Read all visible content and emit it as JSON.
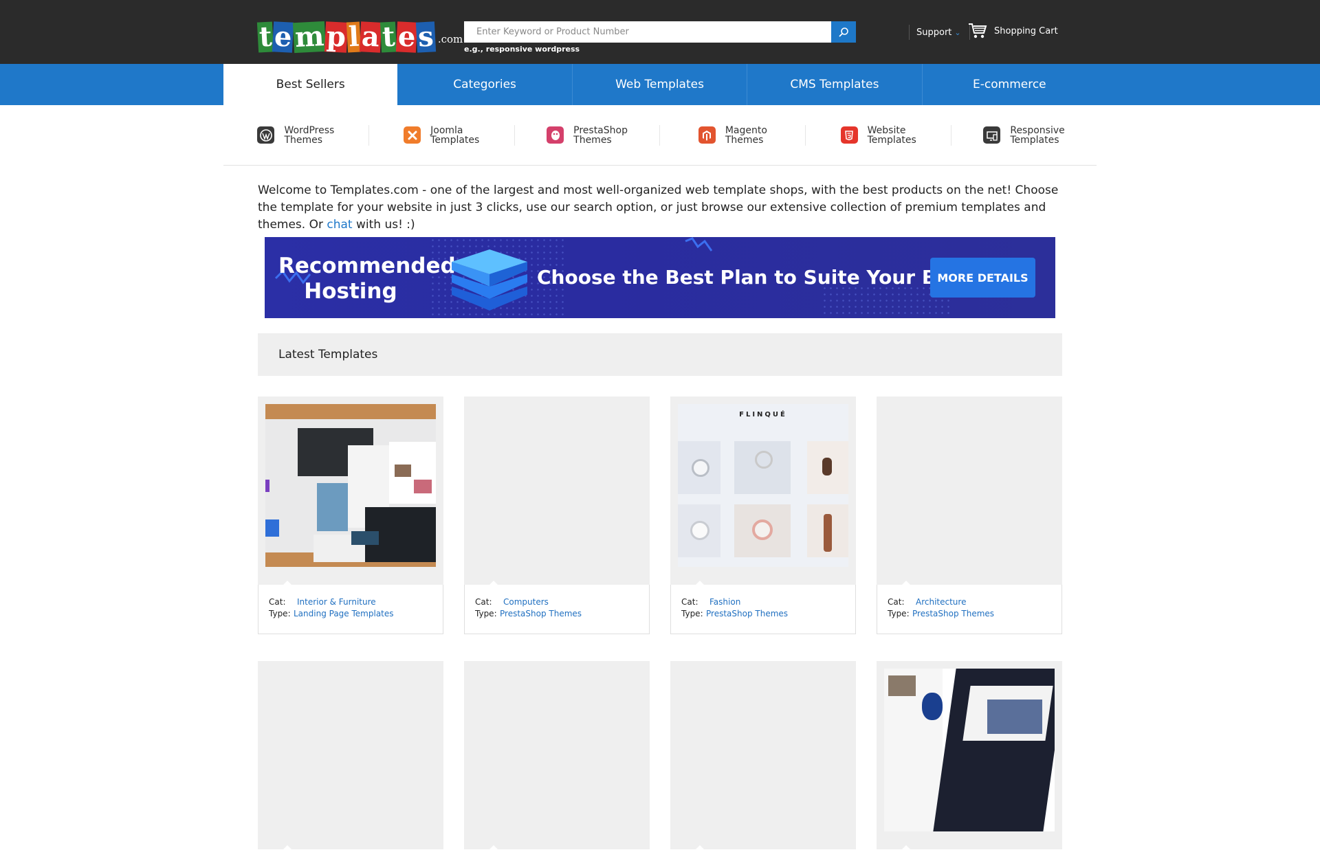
{
  "header": {
    "logo": {
      "letters": [
        {
          "ch": "t",
          "bg": "#2e8b3a"
        },
        {
          "ch": "e",
          "bg": "#1d5fb0"
        },
        {
          "ch": "m",
          "bg": "#2e8b3a"
        },
        {
          "ch": "p",
          "bg": "#d92c2c"
        },
        {
          "ch": "l",
          "bg": "#e07a1a"
        },
        {
          "ch": "a",
          "bg": "#d92c2c"
        },
        {
          "ch": "t",
          "bg": "#2e8b3a"
        },
        {
          "ch": "e",
          "bg": "#d92c2c"
        },
        {
          "ch": "s",
          "bg": "#1d5fb0"
        }
      ],
      "suffix": ".com"
    },
    "search": {
      "placeholder": "Enter Keyword or Product Number",
      "hint": "e.g., responsive wordpress"
    },
    "support_label": "Support",
    "cart_label": "Shopping Cart"
  },
  "nav": {
    "tabs": [
      {
        "label": "Best Sellers",
        "active": true
      },
      {
        "label": "Categories"
      },
      {
        "label": "Web Templates"
      },
      {
        "label": "CMS Templates"
      },
      {
        "label": "E-commerce"
      }
    ]
  },
  "subnav": {
    "items": [
      {
        "line1": "WordPress",
        "line2": "Themes",
        "icon": "wordpress-icon",
        "color": "#3a3a3a"
      },
      {
        "line1": "Joomla",
        "line2": "Templates",
        "icon": "joomla-icon",
        "color": "#f07c2b"
      },
      {
        "line1": "PrestaShop",
        "line2": "Themes",
        "icon": "prestashop-icon",
        "color": "#d4406b"
      },
      {
        "line1": "Magento",
        "line2": "Themes",
        "icon": "magento-icon",
        "color": "#e2542f"
      },
      {
        "line1": "Website",
        "line2": "Templates",
        "icon": "html5-icon",
        "color": "#e5352b"
      },
      {
        "line1": "Responsive",
        "line2": "Templates",
        "icon": "responsive-icon",
        "color": "#3a3a3a"
      }
    ]
  },
  "welcome": {
    "text_before": "Welcome to Templates.com - one of the largest and most well-organized web template shops, with the best products on the net! Choose the template for your website in just 3 clicks, use our search option, or just browse our extensive collection of premium templates and themes. Or ",
    "link": "chat",
    "text_after": " with us! :)"
  },
  "banner": {
    "title_line1": "Recommended",
    "title_line2": "Hosting",
    "tagline": "Choose the Best Plan to Suite Your Business",
    "button": "MORE DETAILS"
  },
  "latest": {
    "heading": "Latest Templates",
    "cat_label": "Cat:",
    "type_label": "Type:",
    "cards": [
      {
        "cat": "Interior & Furniture",
        "type": "Landing Page Templates",
        "thumb": "collage"
      },
      {
        "cat": "Computers",
        "type": "PrestaShop Themes",
        "thumb": "empty"
      },
      {
        "cat": "Fashion",
        "type": "PrestaShop Themes",
        "thumb": "flinque",
        "brand": "FLINQUÉ"
      },
      {
        "cat": "Architecture",
        "type": "PrestaShop Themes",
        "thumb": "empty"
      },
      {
        "thumb": "empty"
      },
      {
        "thumb": "empty"
      },
      {
        "thumb": "empty"
      },
      {
        "thumb": "screens"
      }
    ]
  }
}
